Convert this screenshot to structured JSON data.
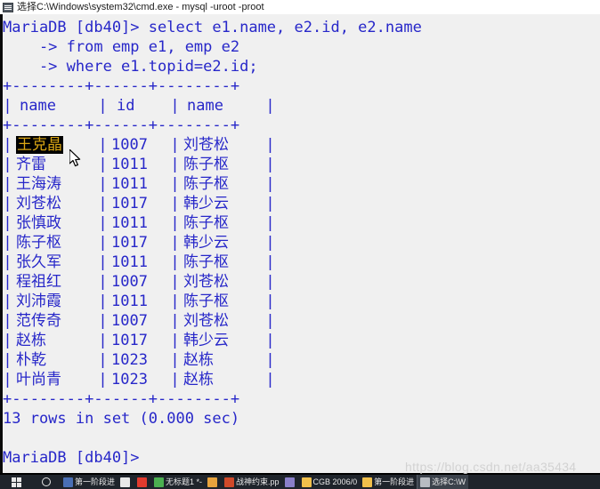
{
  "window": {
    "title": "选择C:\\Windows\\system32\\cmd.exe - mysql  -uroot -proot",
    "icon": "cmd-icon"
  },
  "colors": {
    "console_background": "#f0f0f0",
    "console_text": "#2727c9",
    "selection_background": "#000000",
    "selection_text": "#d9a514",
    "titlebar_background": "#ffffff",
    "taskbar_background": "#1f242b",
    "watermark_text": "#d2d2d2"
  },
  "console": {
    "prompt_line": "MariaDB [db40]> select e1.name, e2.id, e2.name",
    "continuation_1": "    -> from emp e1, emp e2",
    "continuation_2": "    -> where e1.topid=e2.id;",
    "separator": "+--------+------+--------+",
    "row_bar": "|",
    "result_text": "13 rows in set (0.000 sec)",
    "final_prompt": "MariaDB [db40]>",
    "headers": [
      "name",
      "id",
      "name"
    ],
    "rows": [
      {
        "name": "王克晶",
        "id": "1007",
        "name2": "刘苍松",
        "selected": true
      },
      {
        "name": "齐雷",
        "id": "1011",
        "name2": "陈子枢",
        "selected": false
      },
      {
        "name": "王海涛",
        "id": "1011",
        "name2": "陈子枢",
        "selected": false
      },
      {
        "name": "刘苍松",
        "id": "1017",
        "name2": "韩少云",
        "selected": false
      },
      {
        "name": "张慎政",
        "id": "1011",
        "name2": "陈子枢",
        "selected": false
      },
      {
        "name": "陈子枢",
        "id": "1017",
        "name2": "韩少云",
        "selected": false
      },
      {
        "name": "张久军",
        "id": "1011",
        "name2": "陈子枢",
        "selected": false
      },
      {
        "name": "程祖红",
        "id": "1007",
        "name2": "刘苍松",
        "selected": false
      },
      {
        "name": "刘沛霞",
        "id": "1011",
        "name2": "陈子枢",
        "selected": false
      },
      {
        "name": "范传奇",
        "id": "1007",
        "name2": "刘苍松",
        "selected": false
      },
      {
        "name": "赵栋",
        "id": "1017",
        "name2": "韩少云",
        "selected": false
      },
      {
        "name": "朴乾",
        "id": "1023",
        "name2": "赵栋",
        "selected": false
      },
      {
        "name": "叶尚青",
        "id": "1023",
        "name2": "赵栋",
        "selected": false
      }
    ]
  },
  "watermark": {
    "text": "https://blog.csdn.net/aa35434"
  },
  "taskbar": {
    "start_label": "start-icon",
    "search_label": "search-icon",
    "items": [
      {
        "label": "第一阶段进",
        "color": "#4a6fb5",
        "icon": "document-icon"
      },
      {
        "label": "",
        "color": "#e8e8e8",
        "icon": "chrome-icon"
      },
      {
        "label": "",
        "color": "#e23b2e",
        "icon": "pdf-icon"
      },
      {
        "label": "无标题1 *-",
        "color": "#4caf50",
        "icon": "editor-icon"
      },
      {
        "label": "",
        "color": "#e8a33d",
        "icon": "app-icon"
      },
      {
        "label": "战神约束.pp",
        "color": "#d04a2a",
        "icon": "powerpoint-icon"
      },
      {
        "label": "",
        "color": "#8a7fc9",
        "icon": "printer-icon"
      },
      {
        "label": "CGB 2006/0",
        "color": "#f2c04b",
        "icon": "folder-icon"
      },
      {
        "label": "第一阶段进",
        "color": "#f2c04b",
        "icon": "folder-icon"
      },
      {
        "label": "选择C:\\W",
        "color": "#b8bcc2",
        "icon": "cmd-icon"
      }
    ]
  }
}
